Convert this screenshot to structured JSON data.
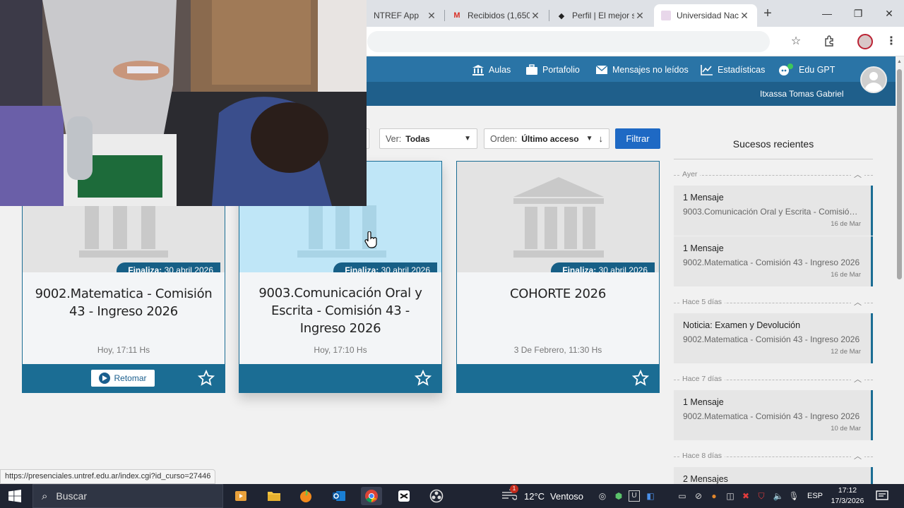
{
  "browser": {
    "tabs": [
      {
        "title": "NTREF App",
        "active": false
      },
      {
        "title": "Recibidos (1,650",
        "active": false
      },
      {
        "title": "Perfil | El mejor s",
        "active": false
      },
      {
        "title": "Universidad Nac",
        "active": true
      }
    ],
    "new_tab": "+",
    "status_url": "https://presenciales.untref.edu.ar/index.cgi?id_curso=27446"
  },
  "header": {
    "nav": [
      {
        "label": "Aulas",
        "icon": "institution-icon"
      },
      {
        "label": "Portafolio",
        "icon": "briefcase-icon"
      },
      {
        "label": "Mensajes no leídos",
        "icon": "envelope-icon"
      },
      {
        "label": "Estadísticas",
        "icon": "line-chart-icon"
      },
      {
        "label": "Edu GPT",
        "icon": "chat-bot-icon"
      }
    ],
    "user_name": "Itxassa Tomas Gabriel"
  },
  "filters": {
    "ver_label": "Ver:",
    "ver_value": "Todas",
    "orden_label": "Orden:",
    "orden_value": "Último acceso",
    "sort_arrow": "↓",
    "filter_button": "Filtrar"
  },
  "courses": [
    {
      "finaliza_label": "Finaliza:",
      "finaliza_date": "30 abril 2026",
      "title": "9002.Matematica - Comisión 43 - Ingreso 2026",
      "last_access": "Hoy, 17:11 Hs",
      "resume_label": "Retomar"
    },
    {
      "finaliza_label": "Finaliza:",
      "finaliza_date": "30 abril 2026",
      "title": "9003.Comunicación Oral y Escrita - Comisión 43 - Ingreso 2026",
      "last_access": "Hoy, 17:10 Hs"
    },
    {
      "finaliza_label": "Finaliza:",
      "finaliza_date": "30 abril 2026",
      "title": "COHORTE 2026",
      "last_access": "3 De Febrero, 11:30 Hs"
    }
  ],
  "sidebar": {
    "title": "Sucesos recientes",
    "groups": [
      {
        "label": "Ayer",
        "events": [
          {
            "title": "1 Mensaje",
            "subtitle": "9003.Comunicación Oral y Escrita - Comisión 43 - Ingreso 2026",
            "date": "16 de Mar"
          },
          {
            "title": "1 Mensaje",
            "subtitle": "9002.Matematica - Comisión 43 - Ingreso 2026",
            "date": "16 de Mar"
          }
        ]
      },
      {
        "label": "Hace 5 días",
        "events": [
          {
            "title": "Noticia: Examen y Devolución",
            "subtitle": "9002.Matematica - Comisión 43 - Ingreso 2026",
            "date": "12 de Mar"
          }
        ]
      },
      {
        "label": "Hace 7 días",
        "events": [
          {
            "title": "1 Mensaje",
            "subtitle": "9002.Matematica - Comisión 43 - Ingreso 2026",
            "date": "10 de Mar"
          }
        ]
      },
      {
        "label": "Hace 8 días",
        "events": [
          {
            "title": "2 Mensajes",
            "subtitle": "",
            "date": ""
          }
        ]
      }
    ]
  },
  "taskbar": {
    "search_placeholder": "Buscar",
    "weather_temp": "12°C",
    "weather_desc": "Ventoso",
    "weather_badge": "1",
    "language": "ESP",
    "time": "17:12",
    "date": "17/3/2026"
  },
  "colors": {
    "header_blue": "#2a74a6",
    "card_footer": "#1b6d94",
    "filter_button": "#1e69c4"
  }
}
